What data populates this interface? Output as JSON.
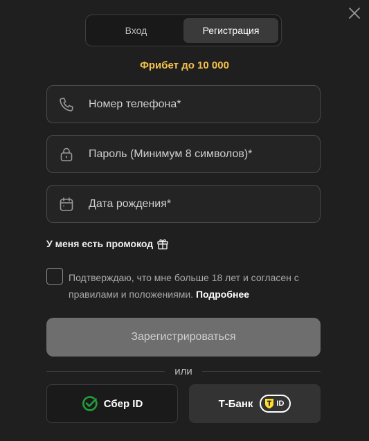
{
  "tabs": [
    {
      "label": "Вход",
      "active": false
    },
    {
      "label": "Регистрация",
      "active": true
    }
  ],
  "promo_banner": "Фрибет до 10 000",
  "fields": {
    "phone": {
      "placeholder": "Номер телефона*",
      "icon": "phone-icon"
    },
    "password": {
      "placeholder": "Пароль (Минимум 8 символов)*",
      "icon": "lock-icon"
    },
    "birthdate": {
      "placeholder": "Дата рождения*",
      "icon": "calendar-icon"
    }
  },
  "promo_code_toggle": {
    "label": "У меня есть промокод",
    "icon": "gift-icon"
  },
  "consent": {
    "text": "Подтверждаю, что мне больше 18 лет и согласен с правилами и положениями.",
    "link": "Подробнее",
    "checked": false
  },
  "submit_label": "Зарегистрироваться",
  "divider_text": "или",
  "social": {
    "sber": {
      "label": "Сбер ID",
      "icon": "sber-check-icon",
      "color": "#21a038"
    },
    "tbank": {
      "label": "Т-Банк",
      "badge": "ID",
      "icon": "tbank-shield-icon",
      "color": "#ffdd2d"
    }
  },
  "colors": {
    "accent": "#f5c24a",
    "background": "#1f1f1f"
  }
}
